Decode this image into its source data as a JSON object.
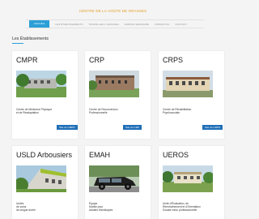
{
  "site_title": "CENTRE DE LA VOÛTE DE GRASSES",
  "nav": {
    "items": [
      {
        "label": "ACCUEIL",
        "active": true
      },
      {
        "label": "LES ÉTABLISSEMENTS",
        "active": false
      },
      {
        "label": "TRAVAILLER À GRASSES",
        "active": false
      },
      {
        "label": "ESPACE SEMINAIRE",
        "active": false
      },
      {
        "label": "FORMATION",
        "active": false
      },
      {
        "label": "CONTACT",
        "active": false
      }
    ]
  },
  "section_title": "Les Établissements",
  "cards": [
    {
      "title": "CMPR",
      "desc_lines": [
        "Centre de Médecine Physique",
        "et de Réadaptation"
      ],
      "button": "Site du CMPR"
    },
    {
      "title": "CRP",
      "desc_lines": [
        "Centre de Reconversion",
        "Professionnelle"
      ],
      "button": "Site du CRP"
    },
    {
      "title": "CRPS",
      "desc_lines": [
        "Centre de Réhabilitation",
        "Psychosociale"
      ],
      "button": "Site du CRPS"
    },
    {
      "title": "USLD Arbousiers",
      "desc_lines": [
        "Unités",
        "de soins",
        "de longue durée"
      ],
      "button": ""
    },
    {
      "title": "EMAH",
      "desc_lines": [
        "Équipe",
        "Mobile pour",
        "Adultes Handicapés"
      ],
      "button": ""
    },
    {
      "title": "UEROS",
      "desc_lines": [
        "Unité d'Évaluation, de",
        "Réentraînement et d'Orientation",
        "Sociale et/ou professionnelle"
      ],
      "button": ""
    }
  ],
  "colors": {
    "accent": "#2c9fd7",
    "title": "#e59a1e",
    "button": "#1f6fb8"
  }
}
